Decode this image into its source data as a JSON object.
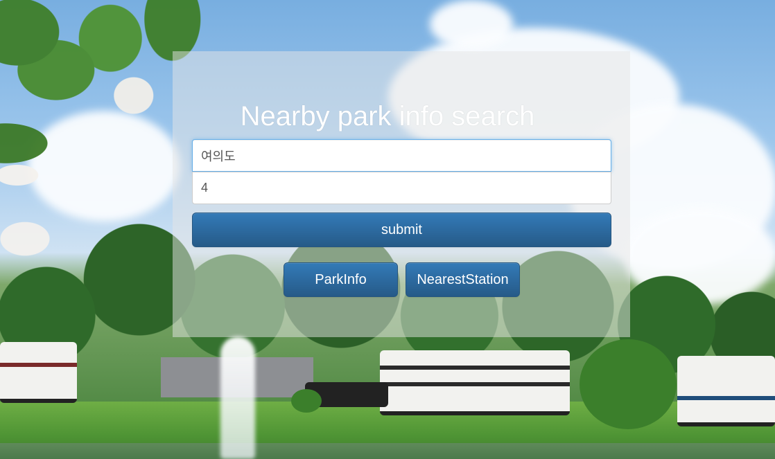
{
  "page": {
    "title": "Nearby park info search"
  },
  "form": {
    "keyword_value": "여의도",
    "count_value": "4",
    "submit_label": "submit"
  },
  "actions": {
    "park_info_label": "ParkInfo",
    "nearest_station_label": "NearestStation"
  },
  "colors": {
    "button_primary": "#337ab7",
    "button_primary_dark": "#265a88",
    "focus_border": "#66afe9",
    "panel_overlay": "rgba(230,230,230,0.5)"
  }
}
